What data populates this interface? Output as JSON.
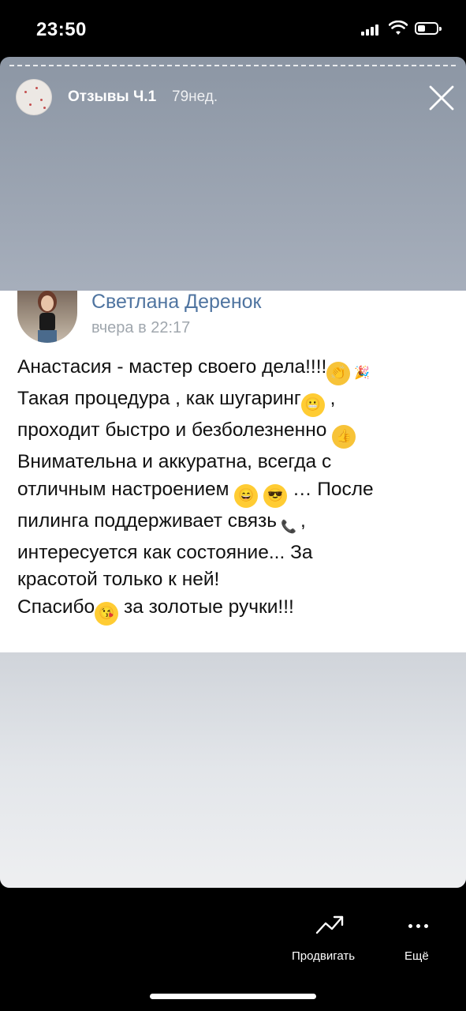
{
  "status_bar": {
    "time": "23:50"
  },
  "story": {
    "title": "Отзывы Ч.1",
    "time_ago": "79нед."
  },
  "post": {
    "author": "Светлана Деренок",
    "date": "вчера в 22:17",
    "lines": [
      "Анастасия - мастер своего дела!!!!",
      "Такая процедура , как шугаринг",
      "проходит быстро и безболезненно",
      "Внимательна и аккуратна, всегда с",
      "отличным настроением",
      "… После",
      "пилинга поддерживает связь",
      "интересуется как состояние... За",
      "красотой только к ней!",
      "Спасибо",
      "за золотые ручки!!!"
    ]
  },
  "bottom_bar": {
    "promote_label": "Продвигать",
    "more_label": "Ещё"
  }
}
